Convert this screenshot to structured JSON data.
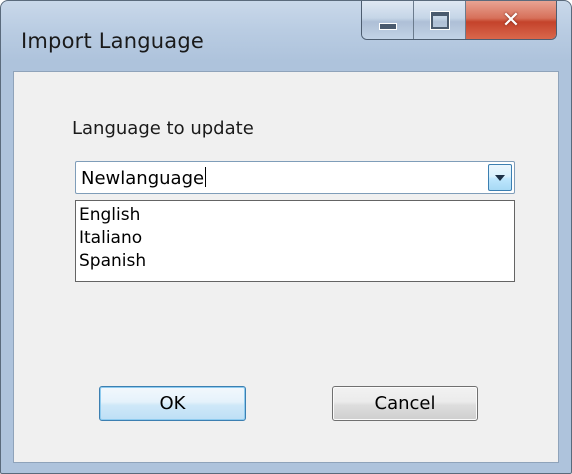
{
  "window": {
    "title": "Import Language",
    "caption_buttons": {
      "minimize_icon": "minimize-icon",
      "maximize_icon": "maximize-icon",
      "close_icon": "close-icon",
      "close_glyph": "✕"
    }
  },
  "form": {
    "label": "Language to update",
    "combo_value": "Newlanguage",
    "dropdown_options": [
      "English",
      "Italiano",
      "Spanish"
    ]
  },
  "buttons": {
    "ok_label": "OK",
    "cancel_label": "Cancel"
  },
  "colors": {
    "frame": "#aec3dc",
    "close": "#c4432b",
    "focus_border": "#3c7fb1"
  }
}
